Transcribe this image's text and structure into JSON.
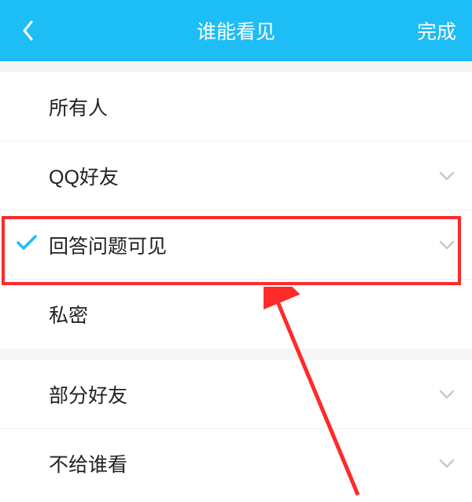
{
  "header": {
    "title": "谁能看见",
    "done_label": "完成"
  },
  "options_group1": [
    {
      "label": "所有人",
      "selected": false,
      "expandable": false
    },
    {
      "label": "QQ好友",
      "selected": false,
      "expandable": true
    },
    {
      "label": "回答问题可见",
      "selected": true,
      "expandable": true
    },
    {
      "label": "私密",
      "selected": false,
      "expandable": false
    }
  ],
  "options_group2": [
    {
      "label": "部分好友",
      "selected": false,
      "expandable": true
    },
    {
      "label": "不给谁看",
      "selected": false,
      "expandable": true
    }
  ],
  "colors": {
    "header_bg": "#1dbdf6",
    "check": "#1dbdf6",
    "highlight": "#ff2a2a",
    "arrow": "#ff2a2a"
  },
  "annotations": {
    "highlight_index": 2,
    "arrow_target": "回答问题可见"
  }
}
